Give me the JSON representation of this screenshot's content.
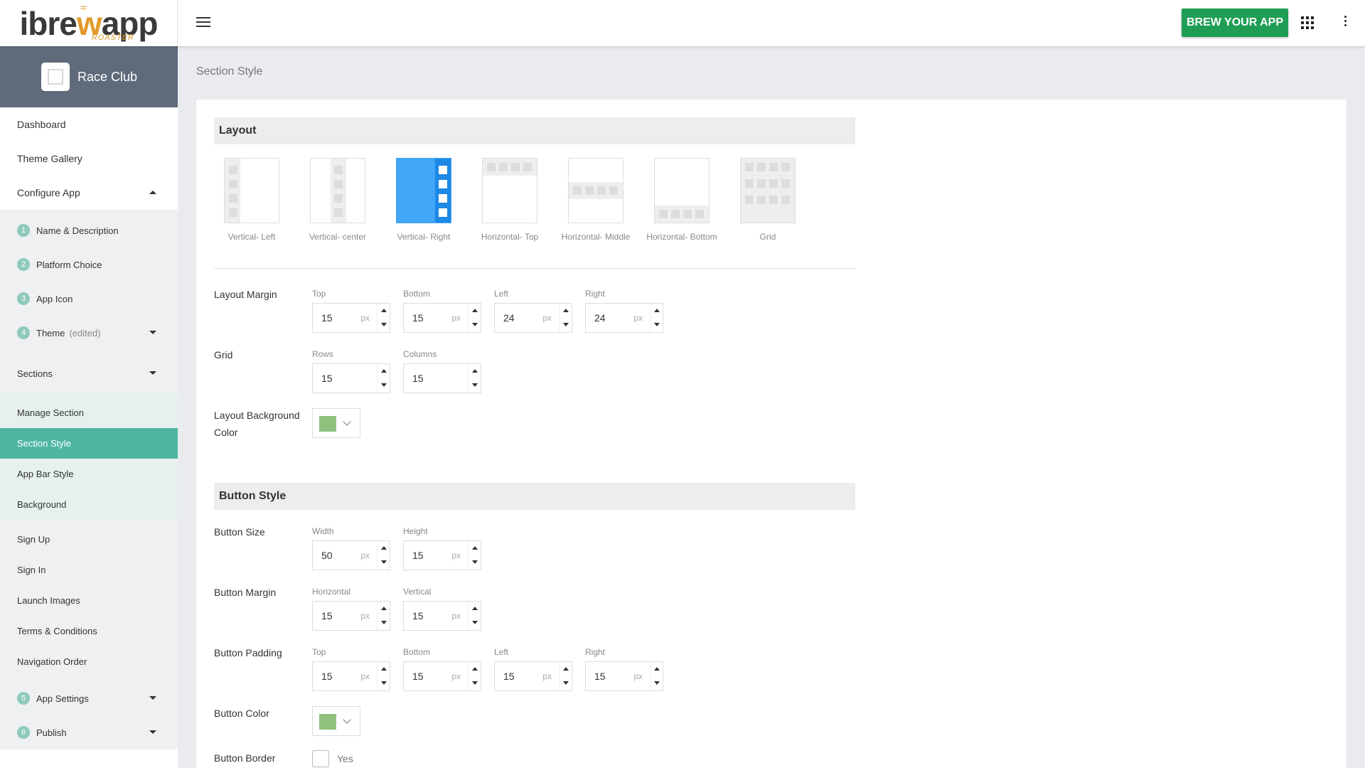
{
  "app": {
    "logo_text_a": "ibre",
    "logo_text_w": "w",
    "logo_text_b": "app",
    "logo_sub": "ROASTER",
    "brew_button": "BREW YOUR APP"
  },
  "sidebar": {
    "app_name": "Race Club",
    "top_items": [
      "Dashboard",
      "Theme Gallery",
      "Configure App"
    ],
    "steps": [
      {
        "num": "1",
        "label": "Name & Description"
      },
      {
        "num": "2",
        "label": "Platform Choice"
      },
      {
        "num": "3",
        "label": "App Icon"
      },
      {
        "num": "4",
        "label": "Theme",
        "note": "(edited)"
      }
    ],
    "sections_label": "Sections",
    "section_items": [
      "Manage Section",
      "Section Style",
      "App Bar Style",
      "Background"
    ],
    "other_items": [
      "Sign Up",
      "Sign In",
      "Launch Images",
      "Terms & Conditions",
      "Navigation Order"
    ],
    "bottom_steps": [
      {
        "num": "5",
        "label": "App Settings"
      },
      {
        "num": "6",
        "label": "Publish"
      }
    ]
  },
  "breadcrumb": "Section Style",
  "layout": {
    "header": "Layout",
    "options": [
      "Vertical- Left",
      "Vertical- center",
      "Vertical- Right",
      "Horizontal- Top",
      "Horizontal- Middle",
      "Horizontal- Bottom",
      "Grid"
    ],
    "selected": "Vertical- Right",
    "margin": {
      "label": "Layout Margin",
      "top_label": "Top",
      "top": "15",
      "bottom_label": "Bottom",
      "bottom": "15",
      "left_label": "Left",
      "left": "24",
      "right_label": "Right",
      "right": "24",
      "unit": "px"
    },
    "grid": {
      "label": "Grid",
      "rows_label": "Rows",
      "rows": "15",
      "columns_label": "Columns",
      "columns": "15"
    },
    "bg_color_label_1": "Layout Background",
    "bg_color_label_2": "Color",
    "bg_color": "#8fc27e"
  },
  "button_style": {
    "header": "Button Style",
    "size": {
      "label": "Button Size",
      "width_label": "Width",
      "width": "50",
      "height_label": "Height",
      "height": "15",
      "unit": "px"
    },
    "margin": {
      "label": "Button Margin",
      "horizontal_label": "Horizontal",
      "horizontal": "15",
      "vertical_label": "Vertical",
      "vertical": "15",
      "unit": "px"
    },
    "padding": {
      "label": "Button Padding",
      "top_label": "Top",
      "top": "15",
      "bottom_label": "Bottom",
      "bottom": "15",
      "left_label": "Left",
      "left": "15",
      "right_label": "Right",
      "right": "15",
      "unit": "px"
    },
    "color_label": "Button Color",
    "color": "#8fc27e",
    "border_label": "Button Border",
    "border_option": "Yes"
  },
  "colors": {
    "brew_green": "#1f9d55",
    "active_teal": "#4fb6a4",
    "selected_blue": "#42a5f5",
    "profile_bg": "#5f6b7a"
  }
}
